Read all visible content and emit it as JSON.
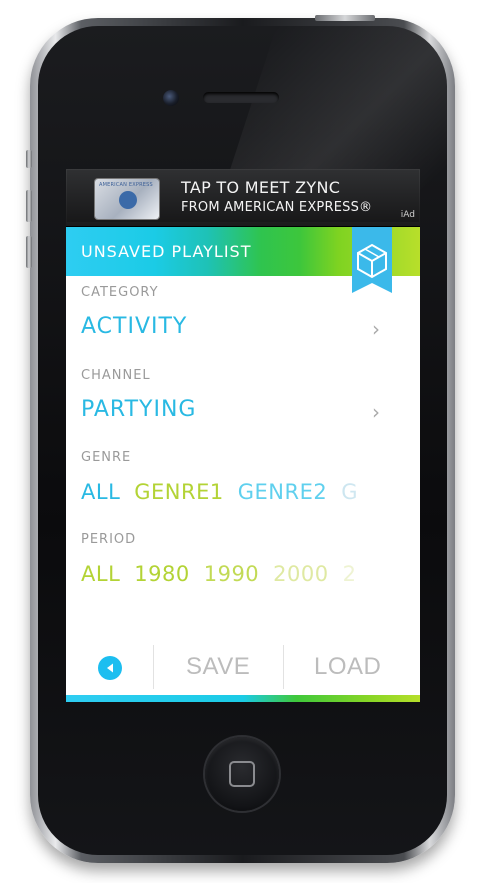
{
  "ad": {
    "card_text": "AMERICAN EXPRESS",
    "line1": "TAP TO MEET ZYNC",
    "line2": "FROM AMERICAN EXPRESS®",
    "badge": "iAd"
  },
  "header": {
    "title": "UNSAVED PLAYLIST",
    "icon": "cube-icon"
  },
  "category": {
    "label": "CATEGORY",
    "value": "ACTIVITY"
  },
  "channel": {
    "label": "CHANNEL",
    "value": "PARTYING"
  },
  "genre": {
    "label": "GENRE",
    "options": [
      "ALL",
      "GENRE1",
      "GENRE2",
      "G"
    ]
  },
  "period": {
    "label": "PERIOD",
    "options": [
      "ALL",
      "1980",
      "1990",
      "2000",
      "2"
    ]
  },
  "toolbar": {
    "save_label": "SAVE",
    "load_label": "LOAD"
  },
  "colors": {
    "cyan": "#29b9e3",
    "green": "#b3d335",
    "label_gray": "#9a9a9a",
    "button_gray": "#bcbcbc"
  }
}
